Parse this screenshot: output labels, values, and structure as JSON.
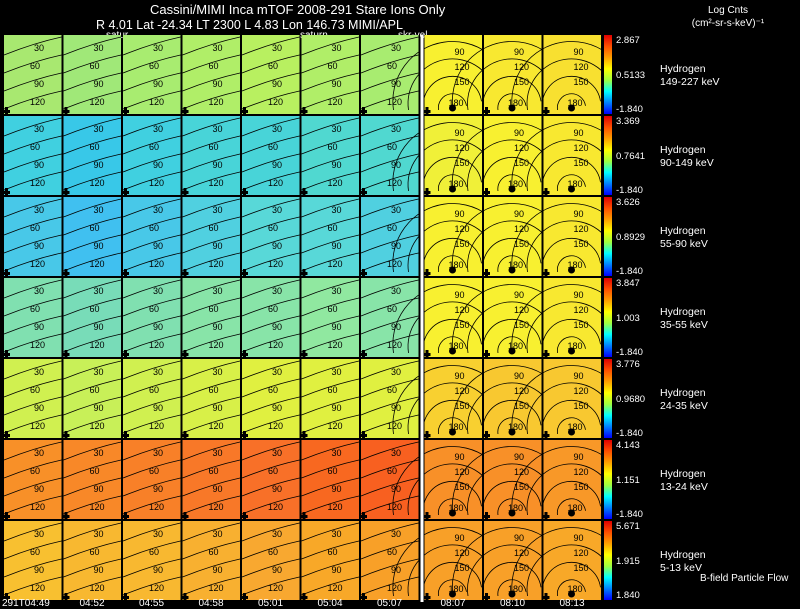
{
  "header": {
    "line1": "Cassini/MIMI Inca mTOF  2008-291   Stare    Ions Only",
    "line2": "R      4.01  Lat -24.34  LT 2300 L       4.83 Lon       146.73  MIMI/APL",
    "label_satur": "satur",
    "label_saturn": "saturn",
    "label_skr": "skr-vel"
  },
  "units": {
    "line1": "Log Cnts",
    "line2": "(cm²-sr-s-keV)⁻¹"
  },
  "footer_note": "B-field Particle Flow",
  "time_labels": [
    "291T04:49",
    "04:52",
    "04:55",
    "04:58",
    "05:01",
    "05:04",
    "05:07",
    "08:07",
    "08:10",
    "08:13"
  ],
  "chart_data": {
    "type": "heatmap",
    "colormap": [
      "#e00000",
      "#ff5000",
      "#ffa000",
      "#ffff00",
      "#a0ff40",
      "#00ffff",
      "#0080ff",
      "#0000ff"
    ],
    "contour_labels_early": [
      "30",
      "60",
      "90",
      "120"
    ],
    "contour_labels_late": [
      "90",
      "120",
      "150",
      "180"
    ],
    "rows": [
      {
        "species": "Hydrogen",
        "energy": "149-227 keV",
        "max": "2.867",
        "mid": "0.5133",
        "min": "-1.840"
      },
      {
        "species": "Hydrogen",
        "energy": "90-149 keV",
        "max": "3.369",
        "mid": "0.7641",
        "min": "-1.840"
      },
      {
        "species": "Hydrogen",
        "energy": "55-90 keV",
        "max": "3.626",
        "mid": "0.8929",
        "min": "-1.840"
      },
      {
        "species": "Hydrogen",
        "energy": "35-55 keV",
        "max": "3.847",
        "mid": "1.003",
        "min": "-1.840"
      },
      {
        "species": "Hydrogen",
        "energy": "24-35 keV",
        "max": "3.776",
        "mid": "0.9680",
        "min": "-1.840"
      },
      {
        "species": "Hydrogen",
        "energy": "13-24 keV",
        "max": "4.143",
        "mid": "1.151",
        "min": "-1.840"
      },
      {
        "species": "Hydrogen",
        "energy": "5-13 keV",
        "max": "5.671",
        "mid": "1.915",
        "min": "1.840"
      }
    ],
    "panel_colors": [
      [
        "#a8e870",
        "#a0e878",
        "#a8ec70",
        "#b0ee68",
        "#b8f060",
        "#b0ee68",
        "#a8ec70",
        "#f8f030",
        "#f8e830",
        "#f8e030"
      ],
      [
        "#40d0e0",
        "#38c8e8",
        "#40d0e0",
        "#48d4d8",
        "#48d4d8",
        "#50d8d0",
        "#50d8d0",
        "#f0f038",
        "#f8f030",
        "#f8e830"
      ],
      [
        "#48c8e8",
        "#40c0f0",
        "#48c8e8",
        "#50d0e0",
        "#58d8d8",
        "#58d8d8",
        "#50d0e0",
        "#f8f030",
        "#f8f030",
        "#f8e830"
      ],
      [
        "#80e0b0",
        "#78dcb8",
        "#80e0b0",
        "#88e4a8",
        "#88e4a8",
        "#90e8a0",
        "#88e4a8",
        "#f8f030",
        "#f8f030",
        "#f8e830"
      ],
      [
        "#d0f050",
        "#c8f058",
        "#d0f050",
        "#d8f048",
        "#e0f040",
        "#e0f040",
        "#e0f040",
        "#f8d030",
        "#f8c830",
        "#f8c830"
      ],
      [
        "#f89028",
        "#f88828",
        "#f88028",
        "#f87828",
        "#f87028",
        "#f86820",
        "#f86020",
        "#f89028",
        "#f89028",
        "#f89828"
      ],
      [
        "#f8c030",
        "#f8b830",
        "#f8b830",
        "#f8b030",
        "#f8a830",
        "#f8a828",
        "#f8a028",
        "#f8a028",
        "#f8a028",
        "#f8a828"
      ]
    ]
  }
}
